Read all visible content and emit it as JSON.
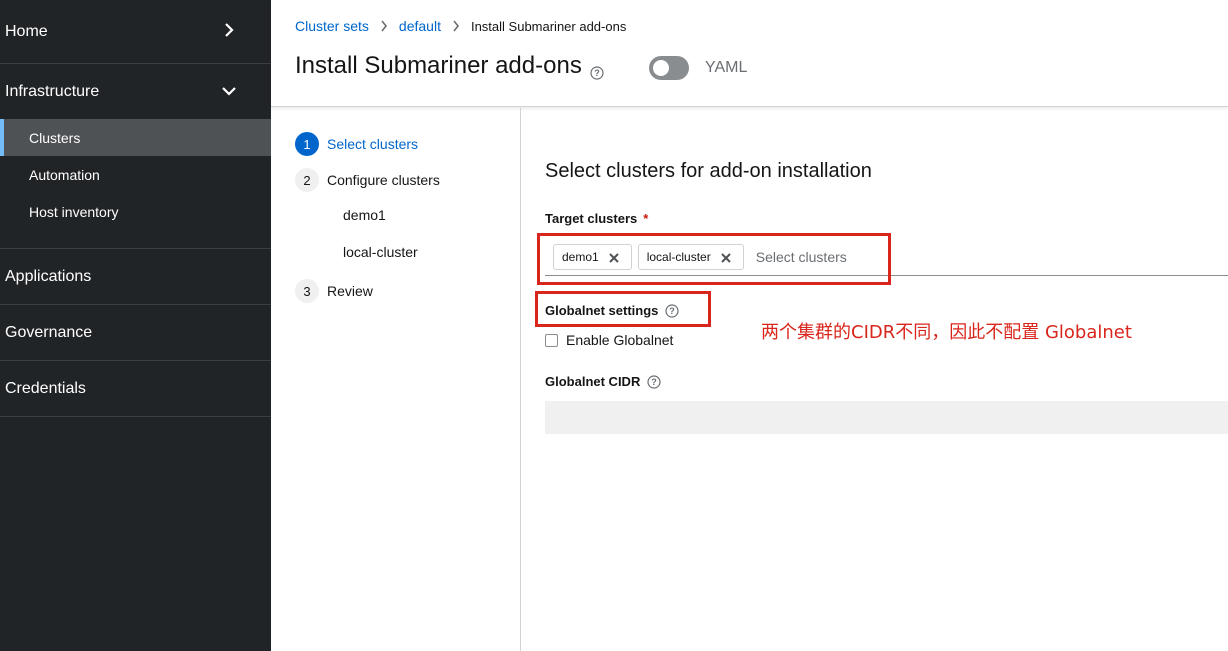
{
  "sidebar": {
    "home": "Home",
    "infrastructure": "Infrastructure",
    "infra_items": [
      "Clusters",
      "Automation",
      "Host inventory"
    ],
    "applications": "Applications",
    "governance": "Governance",
    "credentials": "Credentials"
  },
  "breadcrumb": {
    "items": [
      "Cluster sets",
      "default"
    ],
    "current": "Install Submariner add-ons"
  },
  "header": {
    "title": "Install Submariner add-ons",
    "yaml_label": "YAML"
  },
  "wizard": {
    "steps": [
      {
        "num": "1",
        "label": "Select clusters"
      },
      {
        "num": "2",
        "label": "Configure clusters"
      },
      {
        "num": "3",
        "label": "Review"
      }
    ],
    "sub_steps": [
      "demo1",
      "local-cluster"
    ]
  },
  "form": {
    "title": "Select clusters for add-on installation",
    "target_label": "Target clusters",
    "required_mark": "*",
    "chips": [
      "demo1",
      "local-cluster"
    ],
    "select_placeholder": "Select clusters",
    "globalnet_settings_label": "Globalnet settings",
    "enable_globalnet_label": "Enable Globalnet",
    "globalnet_cidr_label": "Globalnet CIDR"
  },
  "annotation": {
    "note": "两个集群的CIDR不同，因此不配置 Globalnet"
  },
  "colors": {
    "sidebar_bg": "#212427",
    "link": "#0066cc",
    "annotation_red": "#d9261c"
  }
}
